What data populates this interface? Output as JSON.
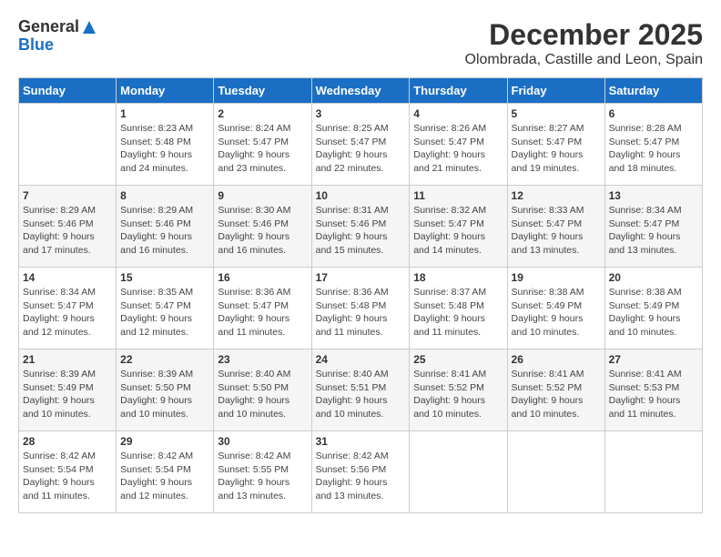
{
  "header": {
    "logo_general": "General",
    "logo_blue": "Blue",
    "month_title": "December 2025",
    "location": "Olombrada, Castille and Leon, Spain"
  },
  "weekdays": [
    "Sunday",
    "Monday",
    "Tuesday",
    "Wednesday",
    "Thursday",
    "Friday",
    "Saturday"
  ],
  "weeks": [
    [
      {
        "day": "",
        "sunrise": "",
        "sunset": "",
        "daylight": ""
      },
      {
        "day": "1",
        "sunrise": "Sunrise: 8:23 AM",
        "sunset": "Sunset: 5:48 PM",
        "daylight": "Daylight: 9 hours and 24 minutes."
      },
      {
        "day": "2",
        "sunrise": "Sunrise: 8:24 AM",
        "sunset": "Sunset: 5:47 PM",
        "daylight": "Daylight: 9 hours and 23 minutes."
      },
      {
        "day": "3",
        "sunrise": "Sunrise: 8:25 AM",
        "sunset": "Sunset: 5:47 PM",
        "daylight": "Daylight: 9 hours and 22 minutes."
      },
      {
        "day": "4",
        "sunrise": "Sunrise: 8:26 AM",
        "sunset": "Sunset: 5:47 PM",
        "daylight": "Daylight: 9 hours and 21 minutes."
      },
      {
        "day": "5",
        "sunrise": "Sunrise: 8:27 AM",
        "sunset": "Sunset: 5:47 PM",
        "daylight": "Daylight: 9 hours and 19 minutes."
      },
      {
        "day": "6",
        "sunrise": "Sunrise: 8:28 AM",
        "sunset": "Sunset: 5:47 PM",
        "daylight": "Daylight: 9 hours and 18 minutes."
      }
    ],
    [
      {
        "day": "7",
        "sunrise": "Sunrise: 8:29 AM",
        "sunset": "Sunset: 5:46 PM",
        "daylight": "Daylight: 9 hours and 17 minutes."
      },
      {
        "day": "8",
        "sunrise": "Sunrise: 8:29 AM",
        "sunset": "Sunset: 5:46 PM",
        "daylight": "Daylight: 9 hours and 16 minutes."
      },
      {
        "day": "9",
        "sunrise": "Sunrise: 8:30 AM",
        "sunset": "Sunset: 5:46 PM",
        "daylight": "Daylight: 9 hours and 16 minutes."
      },
      {
        "day": "10",
        "sunrise": "Sunrise: 8:31 AM",
        "sunset": "Sunset: 5:46 PM",
        "daylight": "Daylight: 9 hours and 15 minutes."
      },
      {
        "day": "11",
        "sunrise": "Sunrise: 8:32 AM",
        "sunset": "Sunset: 5:47 PM",
        "daylight": "Daylight: 9 hours and 14 minutes."
      },
      {
        "day": "12",
        "sunrise": "Sunrise: 8:33 AM",
        "sunset": "Sunset: 5:47 PM",
        "daylight": "Daylight: 9 hours and 13 minutes."
      },
      {
        "day": "13",
        "sunrise": "Sunrise: 8:34 AM",
        "sunset": "Sunset: 5:47 PM",
        "daylight": "Daylight: 9 hours and 13 minutes."
      }
    ],
    [
      {
        "day": "14",
        "sunrise": "Sunrise: 8:34 AM",
        "sunset": "Sunset: 5:47 PM",
        "daylight": "Daylight: 9 hours and 12 minutes."
      },
      {
        "day": "15",
        "sunrise": "Sunrise: 8:35 AM",
        "sunset": "Sunset: 5:47 PM",
        "daylight": "Daylight: 9 hours and 12 minutes."
      },
      {
        "day": "16",
        "sunrise": "Sunrise: 8:36 AM",
        "sunset": "Sunset: 5:47 PM",
        "daylight": "Daylight: 9 hours and 11 minutes."
      },
      {
        "day": "17",
        "sunrise": "Sunrise: 8:36 AM",
        "sunset": "Sunset: 5:48 PM",
        "daylight": "Daylight: 9 hours and 11 minutes."
      },
      {
        "day": "18",
        "sunrise": "Sunrise: 8:37 AM",
        "sunset": "Sunset: 5:48 PM",
        "daylight": "Daylight: 9 hours and 11 minutes."
      },
      {
        "day": "19",
        "sunrise": "Sunrise: 8:38 AM",
        "sunset": "Sunset: 5:49 PM",
        "daylight": "Daylight: 9 hours and 10 minutes."
      },
      {
        "day": "20",
        "sunrise": "Sunrise: 8:38 AM",
        "sunset": "Sunset: 5:49 PM",
        "daylight": "Daylight: 9 hours and 10 minutes."
      }
    ],
    [
      {
        "day": "21",
        "sunrise": "Sunrise: 8:39 AM",
        "sunset": "Sunset: 5:49 PM",
        "daylight": "Daylight: 9 hours and 10 minutes."
      },
      {
        "day": "22",
        "sunrise": "Sunrise: 8:39 AM",
        "sunset": "Sunset: 5:50 PM",
        "daylight": "Daylight: 9 hours and 10 minutes."
      },
      {
        "day": "23",
        "sunrise": "Sunrise: 8:40 AM",
        "sunset": "Sunset: 5:50 PM",
        "daylight": "Daylight: 9 hours and 10 minutes."
      },
      {
        "day": "24",
        "sunrise": "Sunrise: 8:40 AM",
        "sunset": "Sunset: 5:51 PM",
        "daylight": "Daylight: 9 hours and 10 minutes."
      },
      {
        "day": "25",
        "sunrise": "Sunrise: 8:41 AM",
        "sunset": "Sunset: 5:52 PM",
        "daylight": "Daylight: 9 hours and 10 minutes."
      },
      {
        "day": "26",
        "sunrise": "Sunrise: 8:41 AM",
        "sunset": "Sunset: 5:52 PM",
        "daylight": "Daylight: 9 hours and 10 minutes."
      },
      {
        "day": "27",
        "sunrise": "Sunrise: 8:41 AM",
        "sunset": "Sunset: 5:53 PM",
        "daylight": "Daylight: 9 hours and 11 minutes."
      }
    ],
    [
      {
        "day": "28",
        "sunrise": "Sunrise: 8:42 AM",
        "sunset": "Sunset: 5:54 PM",
        "daylight": "Daylight: 9 hours and 11 minutes."
      },
      {
        "day": "29",
        "sunrise": "Sunrise: 8:42 AM",
        "sunset": "Sunset: 5:54 PM",
        "daylight": "Daylight: 9 hours and 12 minutes."
      },
      {
        "day": "30",
        "sunrise": "Sunrise: 8:42 AM",
        "sunset": "Sunset: 5:55 PM",
        "daylight": "Daylight: 9 hours and 13 minutes."
      },
      {
        "day": "31",
        "sunrise": "Sunrise: 8:42 AM",
        "sunset": "Sunset: 5:56 PM",
        "daylight": "Daylight: 9 hours and 13 minutes."
      },
      {
        "day": "",
        "sunrise": "",
        "sunset": "",
        "daylight": ""
      },
      {
        "day": "",
        "sunrise": "",
        "sunset": "",
        "daylight": ""
      },
      {
        "day": "",
        "sunrise": "",
        "sunset": "",
        "daylight": ""
      }
    ]
  ]
}
